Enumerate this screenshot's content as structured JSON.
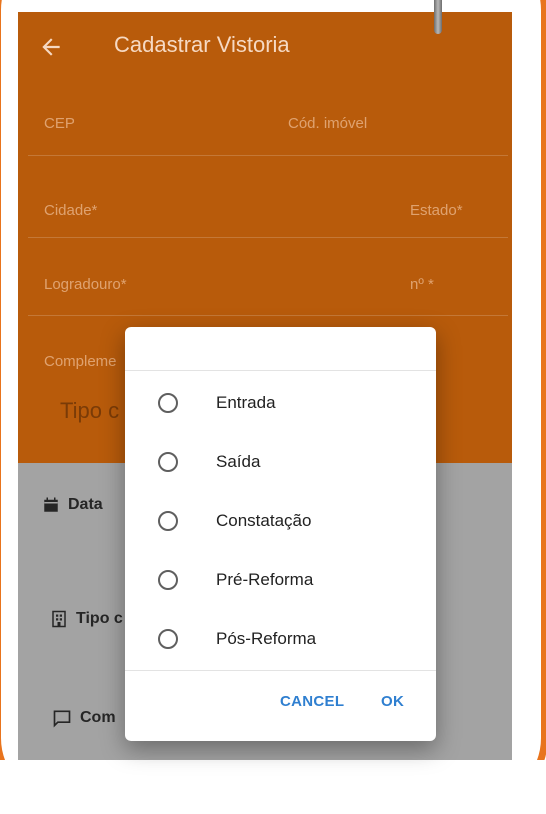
{
  "appbar": {
    "title": "Cadastrar Vistoria",
    "back_icon": "arrow-left-icon"
  },
  "form": {
    "cep": "CEP",
    "cod_imovel": "Cód. imóvel",
    "cidade": "Cidade*",
    "estado": "Estado*",
    "logradouro": "Logradouro*",
    "numero": "nº *",
    "complemento": "Compleme",
    "tipo": "Tipo c"
  },
  "background_items": {
    "data": "Data",
    "tipo": "Tipo c",
    "com": "Com"
  },
  "dialog": {
    "options": [
      "Entrada",
      "Saída",
      "Constatação",
      "Pré-Reforma",
      "Pós-Reforma"
    ],
    "cancel": "CANCEL",
    "ok": "OK"
  },
  "colors": {
    "appbar": "#b85b0b",
    "frame": "#e8741d",
    "button_text": "#2f7fd0"
  }
}
